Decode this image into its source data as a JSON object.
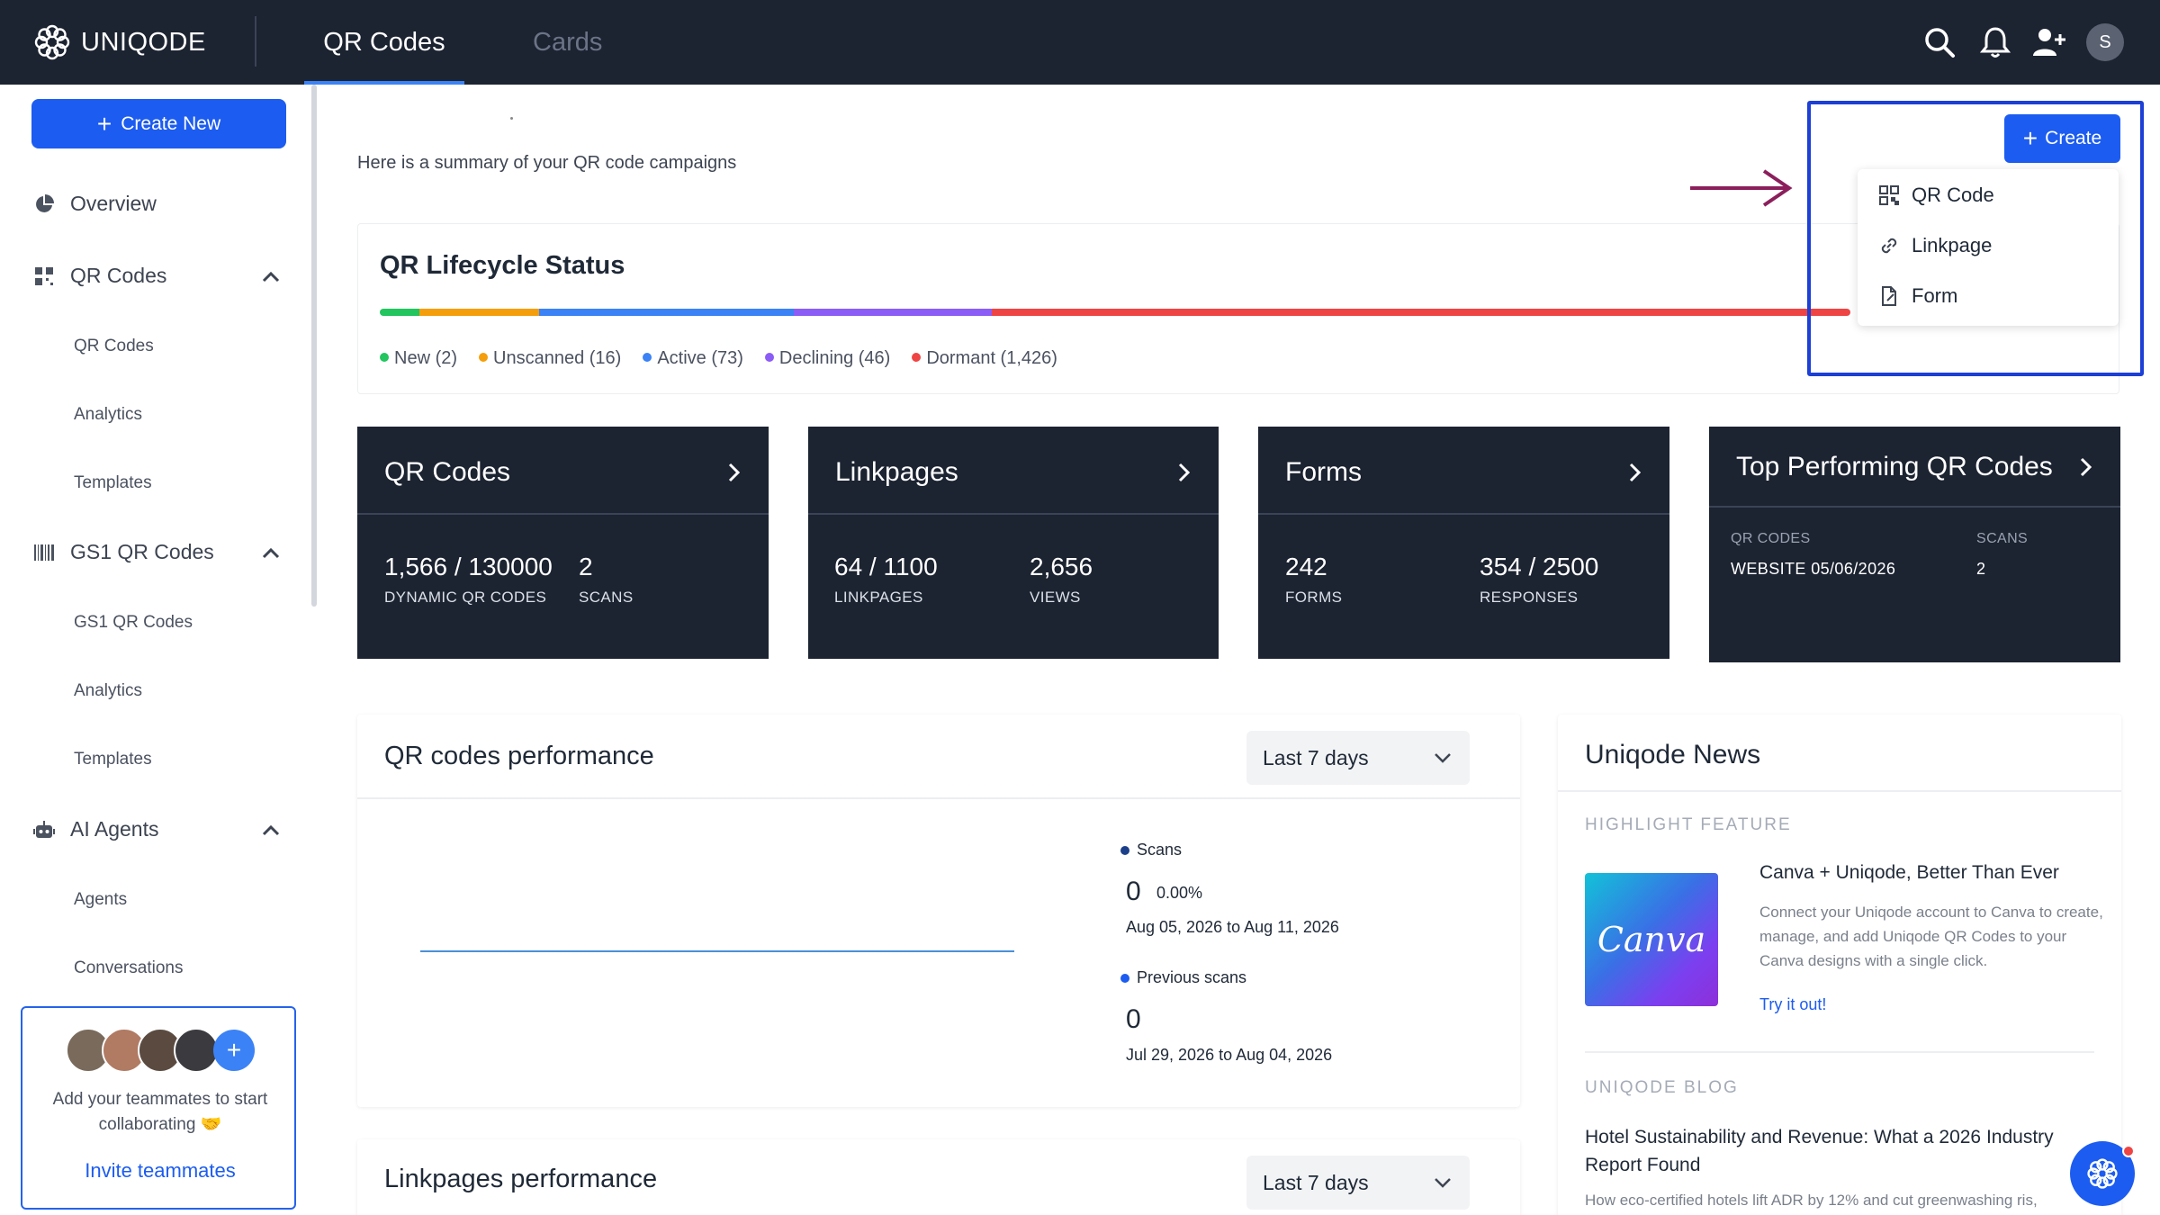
{
  "header": {
    "brand": "UNIQODE",
    "tabs": [
      {
        "label": "QR Codes",
        "active": true
      },
      {
        "label": "Cards",
        "active": false
      }
    ],
    "avatar_initial": "S",
    "icons": [
      "search-icon",
      "bell-icon",
      "add-user-icon"
    ]
  },
  "sidebar": {
    "create_new_label": "Create New",
    "overview": "Overview",
    "groups": [
      {
        "label": "QR Codes",
        "items": [
          "QR Codes",
          "Analytics",
          "Templates"
        ]
      },
      {
        "label": "GS1 QR Codes",
        "items": [
          "GS1 QR Codes",
          "Analytics",
          "Templates"
        ]
      },
      {
        "label": "AI Agents",
        "items": [
          "Agents",
          "Conversations"
        ]
      }
    ],
    "invite": {
      "text": "Add your teammates to start collaborating 🤝",
      "link": "Invite teammates"
    }
  },
  "main": {
    "summary": "Here is a summary of your QR code campaigns",
    "lifecycle": {
      "title": "QR Lifecycle Status",
      "legend": [
        {
          "label": "New (2)",
          "color": "#22c55e"
        },
        {
          "label": "Unscanned (16)",
          "color": "#f59e0b"
        },
        {
          "label": "Active (73)",
          "color": "#3b82f6"
        },
        {
          "label": "Declining (46)",
          "color": "#8b5cf6"
        },
        {
          "label": "Dormant (1,426)",
          "color": "#ef4444"
        }
      ]
    },
    "cards": {
      "qr": {
        "title": "QR Codes",
        "v1": "1,566 / 130000",
        "l1": "DYNAMIC QR CODES",
        "v2": "2",
        "l2": "SCANS"
      },
      "linkpages": {
        "title": "Linkpages",
        "v1": "64 / 1100",
        "l1": "LINKPAGES",
        "v2": "2,656",
        "l2": "VIEWS"
      },
      "forms": {
        "title": "Forms",
        "v1": "242",
        "l1": "FORMS",
        "v2": "354 / 2500",
        "l2": "RESPONSES"
      },
      "top": {
        "title": "Top Performing QR Codes",
        "h1": "QR CODES",
        "h2": "SCANS",
        "r1": "WEBSITE 05/06/2026",
        "r2": "2"
      }
    },
    "performance": {
      "title": "QR codes performance",
      "range": "Last 7 days",
      "scans_label": "Scans",
      "scans_value": "0",
      "scans_pct": "0.00%",
      "scans_range": "Aug 05, 2026 to Aug 11, 2026",
      "prev_label": "Previous scans",
      "prev_value": "0",
      "prev_range": "Jul 29, 2026 to Aug 04, 2026"
    },
    "linkpages_perf": {
      "title": "Linkpages performance",
      "range": "Last 7 days"
    },
    "news": {
      "title": "Uniqode News",
      "highlight_section": "HIGHLIGHT FEATURE",
      "thumb_text": "Canva",
      "headline": "Canva + Uniqode, Better Than Ever",
      "desc": "Connect your Uniqode account to Canva to create, manage, and add Uniqode QR Codes to your Canva designs with a single click.",
      "cta": "Try it out!",
      "blog_section": "UNIQODE BLOG",
      "blog_title": "Hotel Sustainability and Revenue: What a 2026 Industry Report Found",
      "blog_desc": "How eco-certified hotels lift ADR by 12% and cut greenwashing ris,"
    }
  },
  "create_menu": {
    "button": "Create",
    "items": [
      "QR Code",
      "Linkpage",
      "Form"
    ]
  }
}
